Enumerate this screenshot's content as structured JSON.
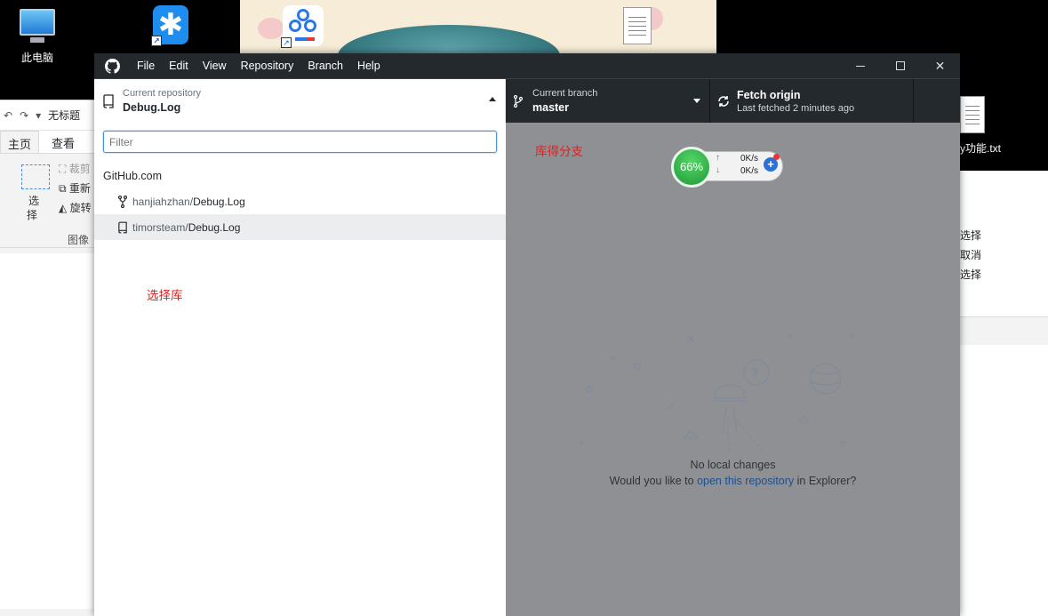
{
  "desktop": {
    "icons": [
      {
        "label": "此电脑",
        "icon": "computer-icon"
      },
      {
        "label": "",
        "icon": "star-app-icon"
      },
      {
        "label": "",
        "icon": "baidu-netdisk-icon"
      },
      {
        "label": "",
        "icon": "text-file-icon"
      }
    ],
    "right_file_label": "y功能.txt"
  },
  "paint": {
    "title": "无标题",
    "tabs": [
      "主页",
      "查看"
    ],
    "ribbon": {
      "select": "选",
      "select2": "择",
      "crop": "裁剪",
      "resize": "重新",
      "rotate": "旋转",
      "group": "图像"
    }
  },
  "right_panel": {
    "options": [
      "选择",
      "取消",
      "选择"
    ]
  },
  "gh": {
    "menu": [
      "File",
      "Edit",
      "View",
      "Repository",
      "Branch",
      "Help"
    ],
    "toolbar": {
      "repo_label": "Current repository",
      "repo_value": "Debug.Log",
      "branch_label": "Current branch",
      "branch_value": "master",
      "fetch_title": "Fetch origin",
      "fetch_sub": "Last fetched 2 minutes ago"
    },
    "filter_placeholder": "Filter",
    "group": "GitHub.com",
    "repos": [
      {
        "owner": "hanjiahzhan/",
        "name": "Debug.Log",
        "icon": "fork-icon"
      },
      {
        "owner": "timorsteam/",
        "name": "Debug.Log",
        "icon": "repo-icon"
      }
    ],
    "annotations": {
      "select_repo": "选择库",
      "branches": "库得分支"
    },
    "empty": {
      "title": "No local changes",
      "prompt_pre": "Would you like to ",
      "prompt_link": "open this repository",
      "prompt_post": " in Explorer?"
    }
  },
  "speed_widget": {
    "percent": "66%",
    "up": "0K/s",
    "down": "0K/s"
  }
}
